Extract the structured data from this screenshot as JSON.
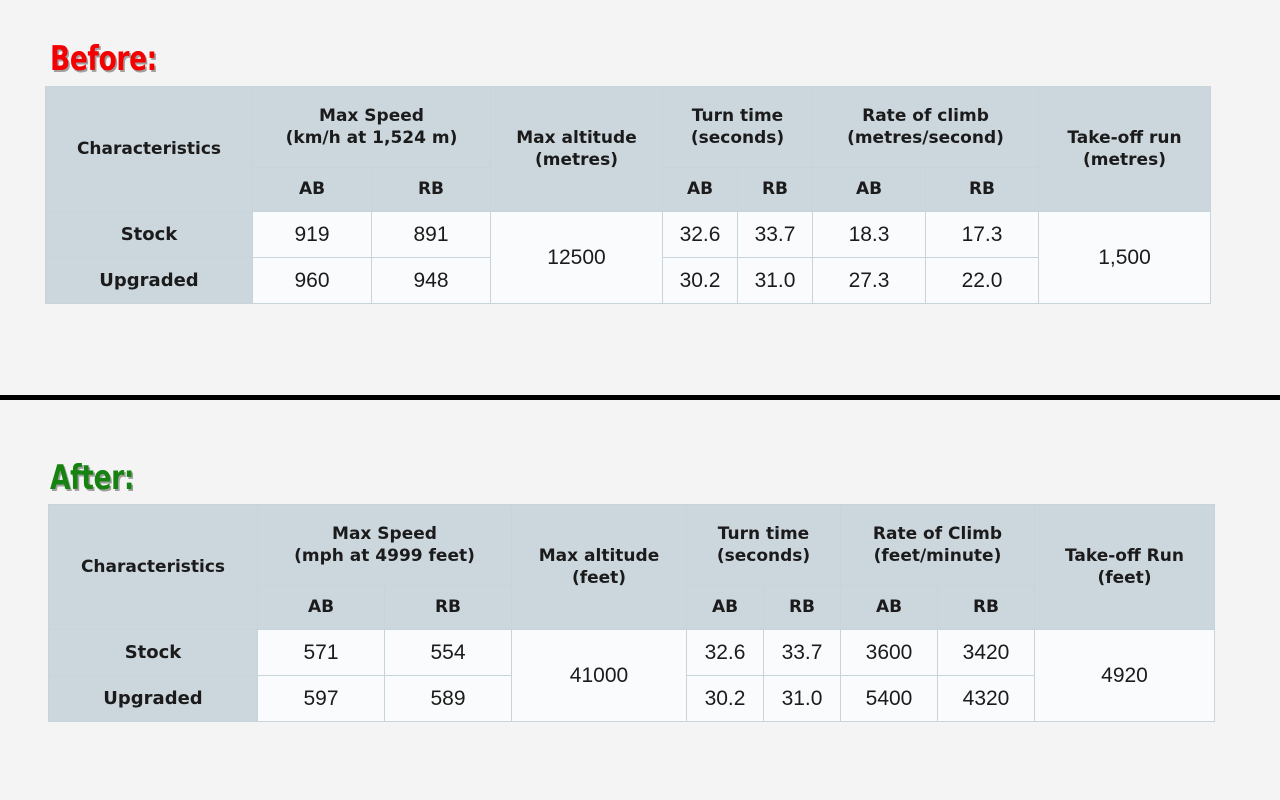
{
  "sections": [
    {
      "label": "Before:",
      "label_color": "#f50000",
      "table": {
        "headers": {
          "characteristics": "Characteristics",
          "max_speed_title": "Max Speed",
          "max_speed_unit": "(km/h at 1,524 m)",
          "max_altitude_title": "Max altitude",
          "max_altitude_unit": "(metres)",
          "turn_time_title": "Turn time",
          "turn_time_unit": "(seconds)",
          "rate_of_climb_title": "Rate of climb",
          "rate_of_climb_unit": "(metres/second)",
          "takeoff_run_title": "Take-off run",
          "takeoff_run_unit": "(metres)",
          "speed_ab": "AB",
          "speed_rb": "RB",
          "turn_ab": "AB",
          "turn_rb": "RB",
          "climb_ab": "AB",
          "climb_rb": "RB"
        },
        "rows": [
          {
            "name": "Stock",
            "speed_ab": "919",
            "speed_rb": "891",
            "turn_ab": "32.6",
            "turn_rb": "33.7",
            "climb_ab": "18.3",
            "climb_rb": "17.3"
          },
          {
            "name": "Upgraded",
            "speed_ab": "960",
            "speed_rb": "948",
            "turn_ab": "30.2",
            "turn_rb": "31.0",
            "climb_ab": "27.3",
            "climb_rb": "22.0"
          }
        ],
        "max_altitude_value": "12500",
        "takeoff_run_value": "1,500"
      }
    },
    {
      "label": "After:",
      "label_color": "#16820f",
      "table": {
        "headers": {
          "characteristics": "Characteristics",
          "max_speed_title": "Max Speed",
          "max_speed_unit": "(mph at 4999 feet)",
          "max_altitude_title": "Max altitude",
          "max_altitude_unit": "(feet)",
          "turn_time_title": "Turn time",
          "turn_time_unit": "(seconds)",
          "rate_of_climb_title": "Rate of Climb",
          "rate_of_climb_unit": "(feet/minute)",
          "takeoff_run_title": "Take-off Run",
          "takeoff_run_unit": "(feet)",
          "speed_ab": "AB",
          "speed_rb": "RB",
          "turn_ab": "AB",
          "turn_rb": "RB",
          "climb_ab": "AB",
          "climb_rb": "RB"
        },
        "rows": [
          {
            "name": "Stock",
            "speed_ab": "571",
            "speed_rb": "554",
            "turn_ab": "32.6",
            "turn_rb": "33.7",
            "climb_ab": "3600",
            "climb_rb": "3420"
          },
          {
            "name": "Upgraded",
            "speed_ab": "597",
            "speed_rb": "589",
            "turn_ab": "30.2",
            "turn_rb": "31.0",
            "climb_ab": "5400",
            "climb_rb": "4320"
          }
        ],
        "max_altitude_value": "41000",
        "takeoff_run_value": "4920"
      }
    }
  ],
  "colors": {
    "page_background": "#f4f4f4",
    "header_cell": "#ccd6dd",
    "data_cell": "#fafbfc",
    "border": "#c9d3da",
    "divider": "#000000",
    "before_label": "#f50000",
    "after_label": "#16820f"
  }
}
